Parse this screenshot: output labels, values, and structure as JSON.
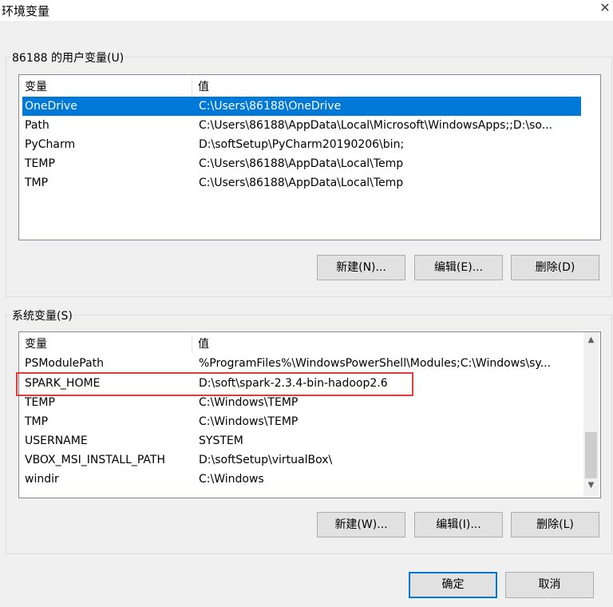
{
  "window": {
    "title": "环境变量",
    "close_glyph": "✕"
  },
  "user_vars": {
    "group_label": "86188 的用户变量(U)",
    "columns": [
      "变量",
      "值"
    ],
    "rows": [
      {
        "name": "OneDrive",
        "value": "C:\\Users\\86188\\OneDrive"
      },
      {
        "name": "Path",
        "value": "C:\\Users\\86188\\AppData\\Local\\Microsoft\\WindowsApps;;D:\\so..."
      },
      {
        "name": "PyCharm",
        "value": "D:\\softSetup\\PyCharm20190206\\bin;"
      },
      {
        "name": "TEMP",
        "value": "C:\\Users\\86188\\AppData\\Local\\Temp"
      },
      {
        "name": "TMP",
        "value": "C:\\Users\\86188\\AppData\\Local\\Temp"
      }
    ],
    "selected_row": "OneDrive",
    "buttons": {
      "new": "新建(N)...",
      "edit": "编辑(E)...",
      "delete": "删除(D)"
    }
  },
  "system_vars": {
    "group_label": "系统变量(S)",
    "columns": [
      "变量",
      "值"
    ],
    "rows": [
      {
        "name": "PSModulePath",
        "value": "%ProgramFiles%\\WindowsPowerShell\\Modules;C:\\Windows\\sy..."
      },
      {
        "name": "SPARK_HOME",
        "value": "D:\\soft\\spark-2.3.4-bin-hadoop2.6"
      },
      {
        "name": "TEMP",
        "value": "C:\\Windows\\TEMP"
      },
      {
        "name": "TMP",
        "value": "C:\\Windows\\TEMP"
      },
      {
        "name": "USERNAME",
        "value": "SYSTEM"
      },
      {
        "name": "VBOX_MSI_INSTALL_PATH",
        "value": "D:\\softSetup\\virtualBox\\"
      },
      {
        "name": "windir",
        "value": "C:\\Windows"
      }
    ],
    "highlighted_row": "SPARK_HOME",
    "buttons": {
      "new": "新建(W)...",
      "edit": "编辑(I)...",
      "delete": "删除(L)"
    }
  },
  "footer": {
    "ok": "确定",
    "cancel": "取消"
  },
  "colors": {
    "selection": "#0078d7",
    "highlight_box": "#e03c3c"
  }
}
